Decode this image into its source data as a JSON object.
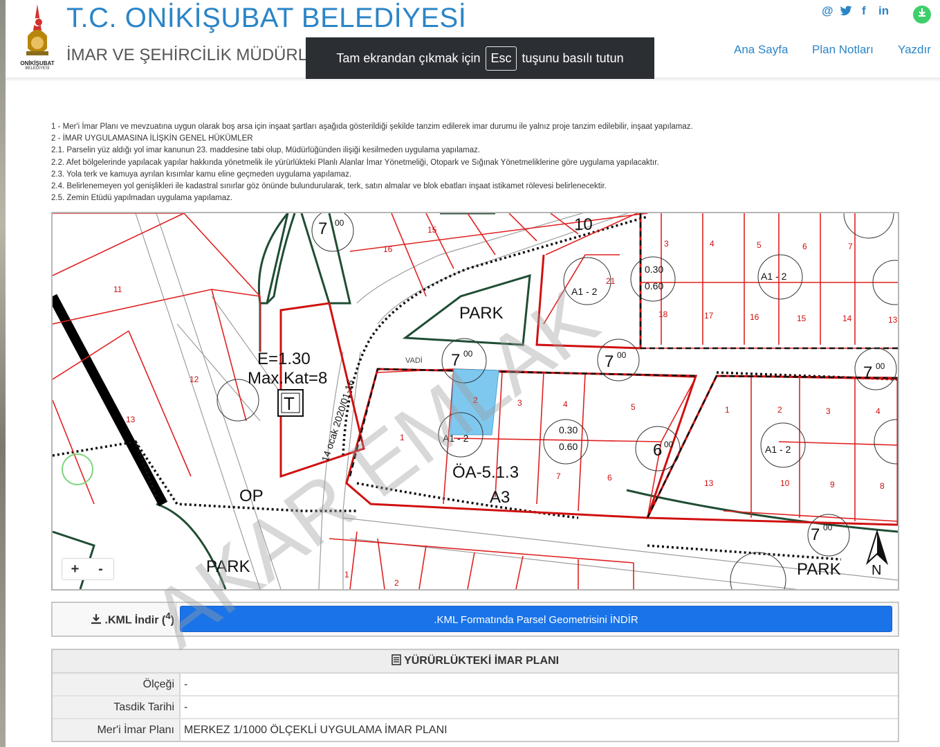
{
  "header": {
    "title": "T.C. ONİKİŞUBAT BELEDİYESİ",
    "subtitle": "İMAR VE ŞEHİRCİLİK MÜDÜRL",
    "logo_text": "ONİKİŞUBAT",
    "logo_sub": "BELEDİYESİ",
    "accent_color": "#2a85c7"
  },
  "fullscreen_notice": {
    "prefix": "Tam ekrandan çıkmak için",
    "key": "Esc",
    "suffix": "tuşunu basılı tutun"
  },
  "social": {
    "email": "@",
    "twitter": "twitter-icon",
    "facebook": "f",
    "linkedin": "in",
    "download": "download-icon"
  },
  "nav": {
    "home": "Ana Sayfa",
    "plan_notes": "Plan Notları",
    "print": "Yazdır"
  },
  "notes": [
    "1 - Mer'i İmar Planı ve mevzuatına uygun olarak boş arsa için inşaat şartları aşağıda gösterildiği şekilde tanzim edilerek imar durumu ile yalnız proje tanzim edilebilir, inşaat yapılamaz.",
    "2 - İMAR UYGULAMASINA İLİŞKİN GENEL HÜKÜMLER",
    "2.1. Parselin yüz aldığı yol imar kanunun 23. maddesine tabi olup, Müdürlüğünden ilişiği kesilmeden uygulama yapılamaz.",
    "2.2. Afet bölgelerinde yapılacak yapılar hakkında yönetmelik ile yürürlükteki Planlı Alanlar İmar Yönetmeliği, Otopark ve Sığınak Yönetmeliklerine göre uygulama yapılacaktır.",
    "2.3. Yola terk ve kamuya ayrılan kısımlar kamu eline geçmeden uygulama yapılamaz.",
    "2.4. Belirlenemeyen yol genişlikleri ile kadastral sınırlar göz önünde bulundurularak, terk, satın almalar ve blok ebatları inşaat istikamet rölevesi belirlenecektir.",
    "2.5. Zemin Etüdü yapılmadan uygulama yapılamaz."
  ],
  "map": {
    "labels": {
      "park1": "PARK",
      "park2": "PARK",
      "park3": "PARK",
      "e_value": "E=1.30",
      "max_kat": "Max.Kat=8",
      "t_symbol": "T",
      "zone": "ÖA-5.1.3",
      "zone2": "A3",
      "op": "OP",
      "road_date": "14 ocak 2020/01-16",
      "vadi": "VADİ",
      "north": "N",
      "road_width": "7",
      "road_sup": "00",
      "road_width_6": "6",
      "road_width_5": "5",
      "road_width_10": "10",
      "ratio1": "0.30",
      "ratio2": "0.60",
      "a1": "A1",
      "a_dash": "A1 - 2",
      "a_top": "5",
      "a_bot": "3",
      "p1": "1",
      "p2": "2",
      "p3": "3",
      "p4": "4",
      "p5": "5",
      "p6": "6",
      "p7": "7",
      "p8": "8",
      "p9": "9",
      "p10": "10",
      "p11": "11",
      "p12": "12",
      "p13": "13",
      "p14": "14",
      "p15": "15",
      "p16": "16",
      "p17": "17",
      "p18": "18",
      "p21": "21"
    },
    "parcel_highlight_color": "#7ec8f0"
  },
  "zoom": {
    "plus": "+",
    "minus": "-"
  },
  "kml": {
    "label": ".KML İndir",
    "sup": "4",
    "button": ".KML Formatında Parsel Geometrisini İNDİR"
  },
  "plan_table": {
    "header": "YÜRÜRLÜKTEKİ İMAR PLANI",
    "rows": [
      {
        "key": "Ölçeği",
        "value": "-"
      },
      {
        "key": "Tasdik Tarihi",
        "value": "-"
      },
      {
        "key": "Mer'i İmar Planı",
        "value": "MERKEZ 1/1000 ÖLÇEKLİ UYGULAMA İMAR PLANI"
      }
    ]
  },
  "watermark": "AKAR EMLAK"
}
